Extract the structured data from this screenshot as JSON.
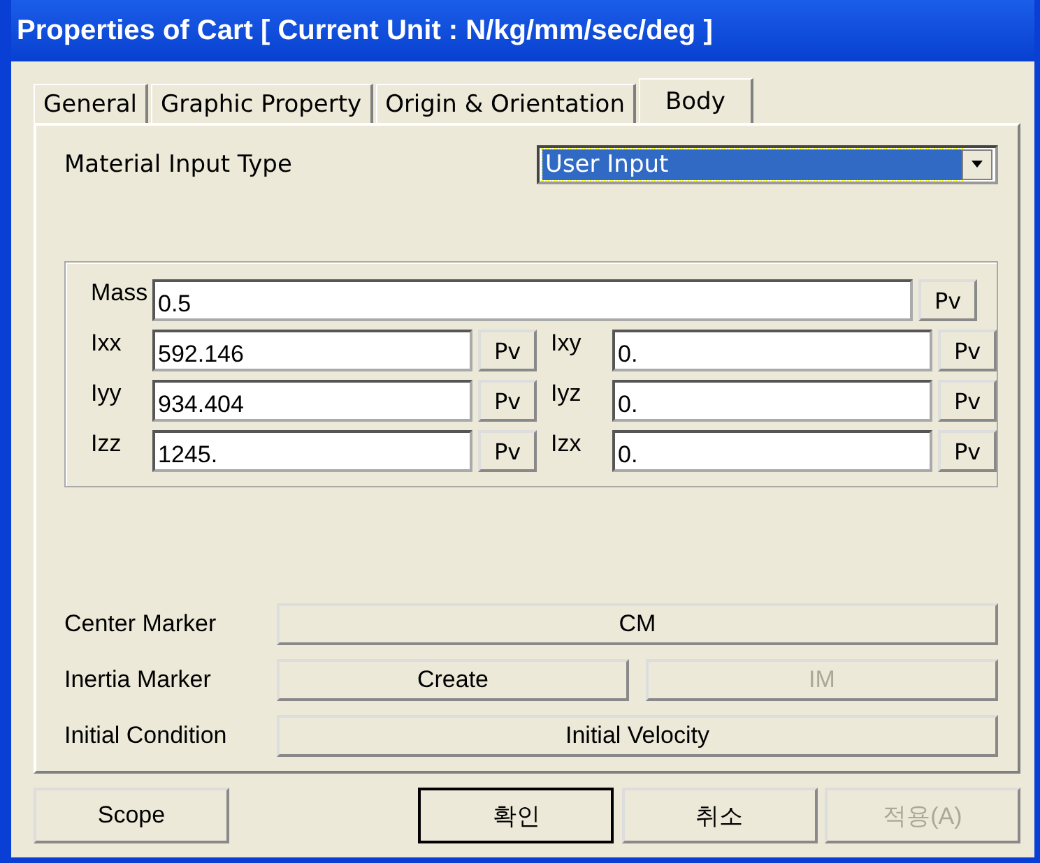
{
  "window": {
    "title": "Properties of Cart [ Current Unit : N/kg/mm/sec/deg ]"
  },
  "tabs": [
    {
      "label": "General",
      "selected": false
    },
    {
      "label": "Graphic Property",
      "selected": false
    },
    {
      "label": "Origin & Orientation",
      "selected": false
    },
    {
      "label": "Body",
      "selected": true
    }
  ],
  "material_input_type": {
    "label": "Material Input Type",
    "value": "User Input"
  },
  "mass": {
    "label": "Mass",
    "value": "0.5",
    "button": "Pv"
  },
  "inertia": [
    {
      "label": "Ixx",
      "value": "592.146",
      "button": "Pv"
    },
    {
      "label": "Ixy",
      "value": "0.",
      "button": "Pv"
    },
    {
      "label": "Iyy",
      "value": "934.404",
      "button": "Pv"
    },
    {
      "label": "Iyz",
      "value": "0.",
      "button": "Pv"
    },
    {
      "label": "Izz",
      "value": "1245.",
      "button": "Pv"
    },
    {
      "label": "Izx",
      "value": "0.",
      "button": "Pv"
    }
  ],
  "markers": [
    {
      "label": "Center Marker",
      "buttons": [
        {
          "label": "CM",
          "disabled": false
        }
      ]
    },
    {
      "label": "Inertia Marker",
      "buttons": [
        {
          "label": "Create",
          "disabled": false
        },
        {
          "label": "IM",
          "disabled": true
        }
      ]
    },
    {
      "label": "Initial Condition",
      "buttons": [
        {
          "label": "Initial Velocity",
          "disabled": false
        }
      ]
    }
  ],
  "footer_buttons": [
    {
      "label": "Scope",
      "disabled": false,
      "default": false
    },
    {
      "label": "확인",
      "disabled": false,
      "default": true
    },
    {
      "label": "취소",
      "disabled": false,
      "default": false
    },
    {
      "label": "적용(A)",
      "disabled": true,
      "default": false
    }
  ]
}
